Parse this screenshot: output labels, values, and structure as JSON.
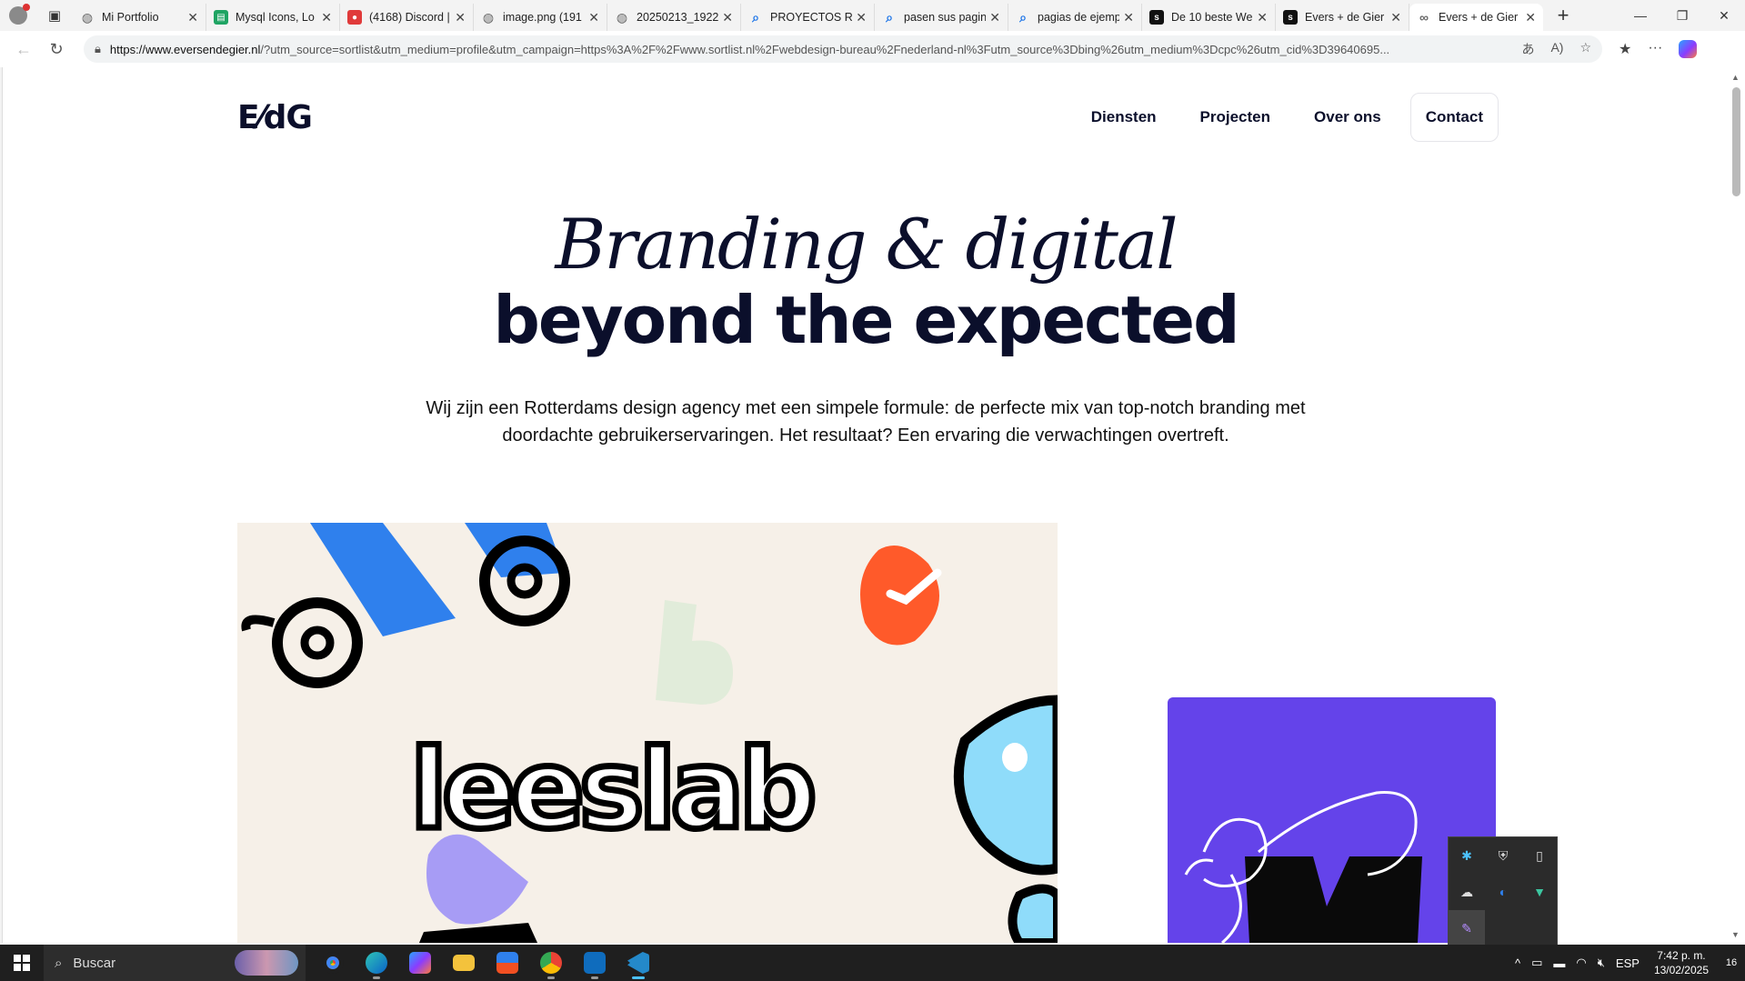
{
  "browser": {
    "tabs": [
      {
        "title": "Mi Portfolio",
        "icon": "globe-icon",
        "color": "#666666"
      },
      {
        "title": "Mysql Icons, Lo",
        "icon": "sheet-icon",
        "color": "#1fa463"
      },
      {
        "title": "(4168) Discord |",
        "icon": "discord-icon",
        "color": "#e03a3a"
      },
      {
        "title": "image.png (191",
        "icon": "globe-icon",
        "color": "#666666"
      },
      {
        "title": "20250213_1922",
        "icon": "globe-icon",
        "color": "#666666"
      },
      {
        "title": "PROYECTOS RE",
        "icon": "search-icon",
        "color": "#1a73e8"
      },
      {
        "title": "pasen sus pagin",
        "icon": "search-icon",
        "color": "#1a73e8"
      },
      {
        "title": "pagias de ejemp",
        "icon": "search-icon",
        "color": "#1a73e8"
      },
      {
        "title": "De 10 beste We",
        "icon": "sortlist-icon",
        "color": "#111111"
      },
      {
        "title": "Evers + de Gier",
        "icon": "sortlist-icon",
        "color": "#111111"
      },
      {
        "title": "Evers + de Gier",
        "icon": "link-icon",
        "color": "#666666",
        "active": true
      }
    ],
    "url_host": "https://www.eversendegier.nl",
    "url_rest": "/?utm_source=sortlist&utm_medium=profile&utm_campaign=https%3A%2F%2Fwww.sortlist.nl%2Fwebdesign-bureau%2Fnederland-nl%3Futm_source%3Dbing%26utm_medium%3Dcpc%26utm_cid%3D39640695..."
  },
  "site": {
    "logo": "E⁄dG",
    "nav": [
      "Diensten",
      "Projecten",
      "Over ons",
      "Contact"
    ],
    "hero_script": "Branding & digital",
    "hero_headline": "beyond the expected",
    "hero_intro": "Wij zijn een Rotterdams design agency met een simpele formule: de perfecte mix van top-notch branding met doordachte gebruikerservaringen. Het resultaat? Een ervaring die verwachtingen overtreft.",
    "project_left_title": "leeslab",
    "colors": {
      "navy": "#0b0f2b",
      "cream": "#f6f0e8",
      "blue": "#2f80ed",
      "orange": "#ff5a2a",
      "lightblue": "#8fdcfa",
      "purple": "#6443ea",
      "lavender": "#a79cf5"
    }
  },
  "taskbar": {
    "search_placeholder": "Buscar",
    "lang": "ESP",
    "time": "7:42 p. m.",
    "date": "13/02/2025",
    "notifications": "16"
  }
}
